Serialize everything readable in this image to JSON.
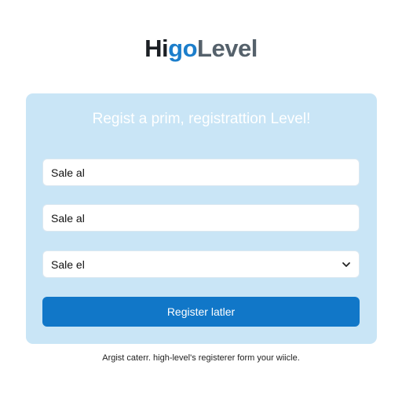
{
  "logo": {
    "part1": "Hi",
    "part2": "go",
    "part3": "Level"
  },
  "form": {
    "title": "Regist a prim, registrattion Level!",
    "field1_value": "Sale al",
    "field2_value": "Sale al",
    "select_value": "Sale el",
    "submit_label": "Register latler"
  },
  "footer": {
    "text": "Argist caterr. high-level's registerer form your wiicle."
  },
  "colors": {
    "accent": "#1177c8",
    "card_bg": "#c9e5f6"
  },
  "icons": {
    "select_chevron": "chevron-down-icon"
  }
}
